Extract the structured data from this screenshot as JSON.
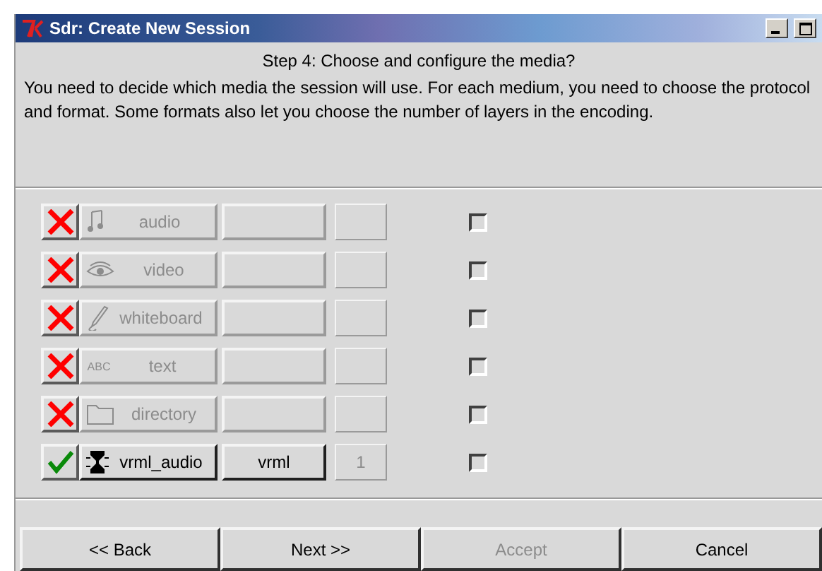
{
  "window": {
    "title": "Sdr: Create New Session"
  },
  "heading": "Step 4: Choose and configure the media?",
  "description": "You need to decide which media the session will use.  For each medium, you need to choose the protocol and format.  Some formats also let you choose the number of layers in the encoding.",
  "media": [
    {
      "kind": "audio",
      "name": "audio",
      "enabled": false,
      "checked": false
    },
    {
      "kind": "video",
      "name": "video",
      "enabled": false,
      "checked": false
    },
    {
      "kind": "whiteboard",
      "name": "whiteboard",
      "enabled": false,
      "checked": false
    },
    {
      "kind": "text",
      "name": "text",
      "icon_label": "ABC",
      "enabled": false,
      "checked": false
    },
    {
      "kind": "directory",
      "name": "directory",
      "enabled": false,
      "checked": false
    },
    {
      "kind": "vrml",
      "name": "vrml_audio",
      "enabled": true,
      "format": "vrml",
      "layers": "1",
      "checked": false
    }
  ],
  "buttons": [
    {
      "label": "<< Back",
      "disabled": false
    },
    {
      "label": "Next >>",
      "disabled": false
    },
    {
      "label": "Accept",
      "disabled": true
    },
    {
      "label": "Cancel",
      "disabled": false
    }
  ]
}
